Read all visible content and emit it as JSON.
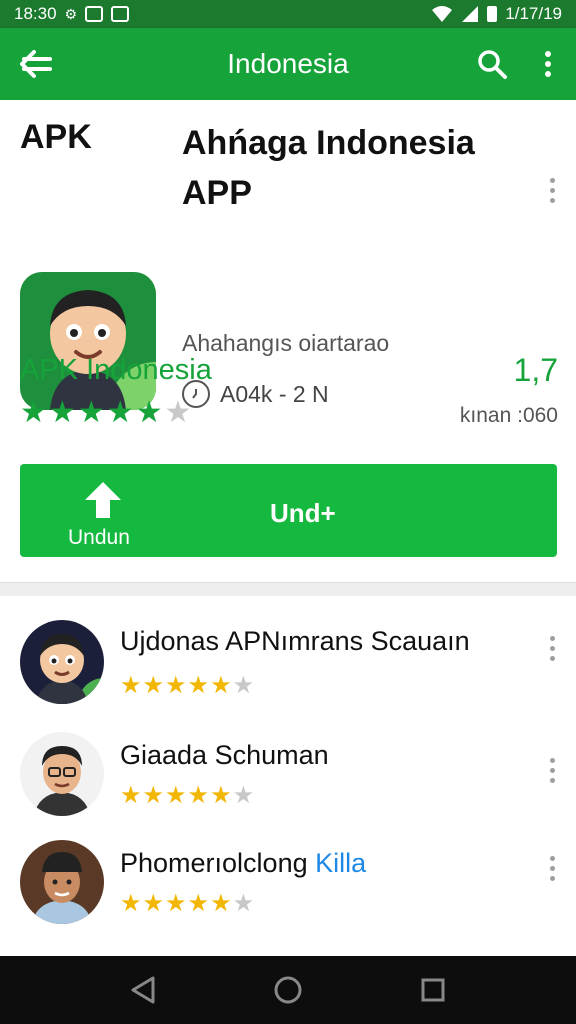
{
  "status_bar": {
    "time": "18:30",
    "clock_right": "1/17/19"
  },
  "app_bar": {
    "title": "Indonesia"
  },
  "header": {
    "tag": "APK",
    "app_name": "Ahńaga Indonesia APP",
    "subtitle": "Ahahangıs oiartarao",
    "meta": "A04k - 2 N"
  },
  "developer": {
    "name": "APK Indonesia",
    "stars_filled": 5,
    "stars_total": 6,
    "rating_value": "1,7",
    "rating_count": "kınan :060"
  },
  "install_button": {
    "small_label": "Undun",
    "main_label": "Und+"
  },
  "list": [
    {
      "title": "Ujdonas APNımrans Scauaın",
      "title_highlight": "",
      "stars_filled": 5,
      "stars_total": 6,
      "avatar": "cartoon-avatar"
    },
    {
      "title": "Giaada Schuman",
      "title_highlight": "",
      "stars_filled": 5,
      "stars_total": 6,
      "avatar": "glasses-avatar"
    },
    {
      "title": "Phomerıolclong",
      "title_highlight": "Killa",
      "stars_filled": 5,
      "stars_total": 6,
      "avatar": "cap-avatar"
    }
  ],
  "colors": {
    "primary": "#16a33a",
    "primary_dark": "#1b7a2e",
    "install": "#16b93f",
    "star_gold": "#f2b705"
  },
  "icons": [
    "back-arrow-icon",
    "search-icon",
    "more-vert-icon",
    "nav-back-icon",
    "nav-home-icon",
    "nav-recents-icon"
  ]
}
